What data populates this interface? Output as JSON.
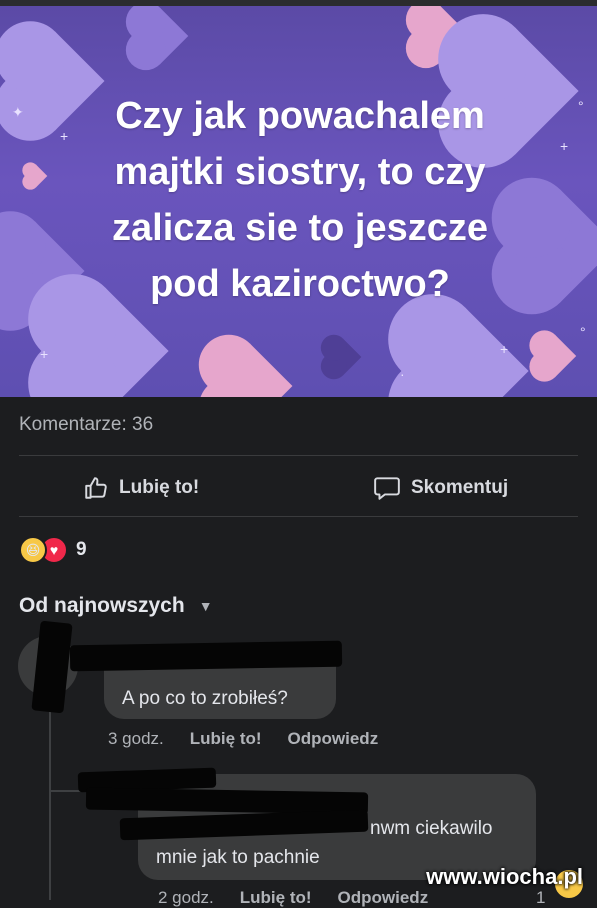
{
  "post": {
    "image_text": "Czy jak powachalem majtki siostry, to czy zalicza sie to jeszcze pod kaziroctwo?",
    "image_lines": [
      "Czy jak powachalem",
      "majtki siostry, to czy",
      "zalicza sie to jeszcze",
      "pod kaziroctwo?"
    ],
    "comments_count": "Komentarze: 36",
    "like_label": "Lubię to!",
    "comment_label": "Skomentuj",
    "reactions": {
      "icons": [
        "haha-icon",
        "love-icon"
      ],
      "count": "9"
    },
    "sort_label": "Od najnowszych"
  },
  "comments": [
    {
      "text": "A po co to zrobiłeś?",
      "time": "3 godz.",
      "like": "Lubię to!",
      "reply": "Odpowiedz"
    },
    {
      "text_line1": "nwm ciekawilo",
      "text_line2": "mnie jak to pachnie",
      "time": "2 godz.",
      "like": "Lubię to!",
      "reply": "Odpowiedz",
      "reaction_count": "1"
    }
  ],
  "watermark": "www.wiocha.pl",
  "colors": {
    "background": "#1c1d1f",
    "hero_purple": "#6a55bd",
    "bubble": "#3a3b3c",
    "text": "#e4e6eb",
    "muted": "#b0b3b8"
  }
}
